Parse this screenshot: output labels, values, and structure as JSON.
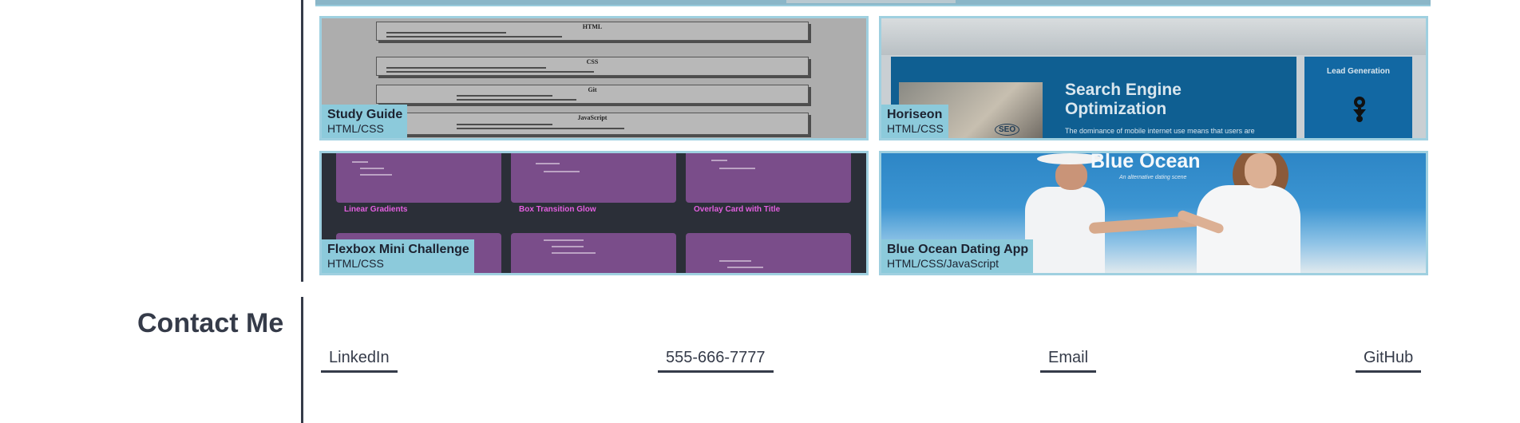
{
  "projects": [
    {
      "title": "Study Guide",
      "tech": "HTML/CSS"
    },
    {
      "title": "Horiseon",
      "tech": "HTML/CSS"
    },
    {
      "title": "Flexbox Mini Challenge",
      "tech": "HTML/CSS"
    },
    {
      "title": "Blue Ocean Dating App",
      "tech": "HTML/CSS/JavaScript"
    }
  ],
  "thumbnails": {
    "study_guide": {
      "headings": [
        "HTML",
        "CSS",
        "Git",
        "JavaScript"
      ]
    },
    "horiseon": {
      "banner_title": "Search Engine Optimization",
      "banner_text": "The dominance of mobile internet use means that users are",
      "side_title": "Lead Generation",
      "photo_label": "SEO"
    },
    "flexbox": {
      "titles": [
        "Linear Gradients",
        "Box Transition Glow",
        "Overlay Card with Title"
      ]
    },
    "blue_ocean": {
      "brand": "Blue Ocean",
      "tagline": "An alternative dating scene"
    }
  },
  "contact": {
    "heading": "Contact Me",
    "links": {
      "linkedin": "LinkedIn",
      "phone": "555-666-7777",
      "email": "Email",
      "github": "GitHub"
    }
  },
  "colors": {
    "text": "#353b49",
    "card_border": "#9fd0e0",
    "caption_bg": "#8ccadb"
  }
}
